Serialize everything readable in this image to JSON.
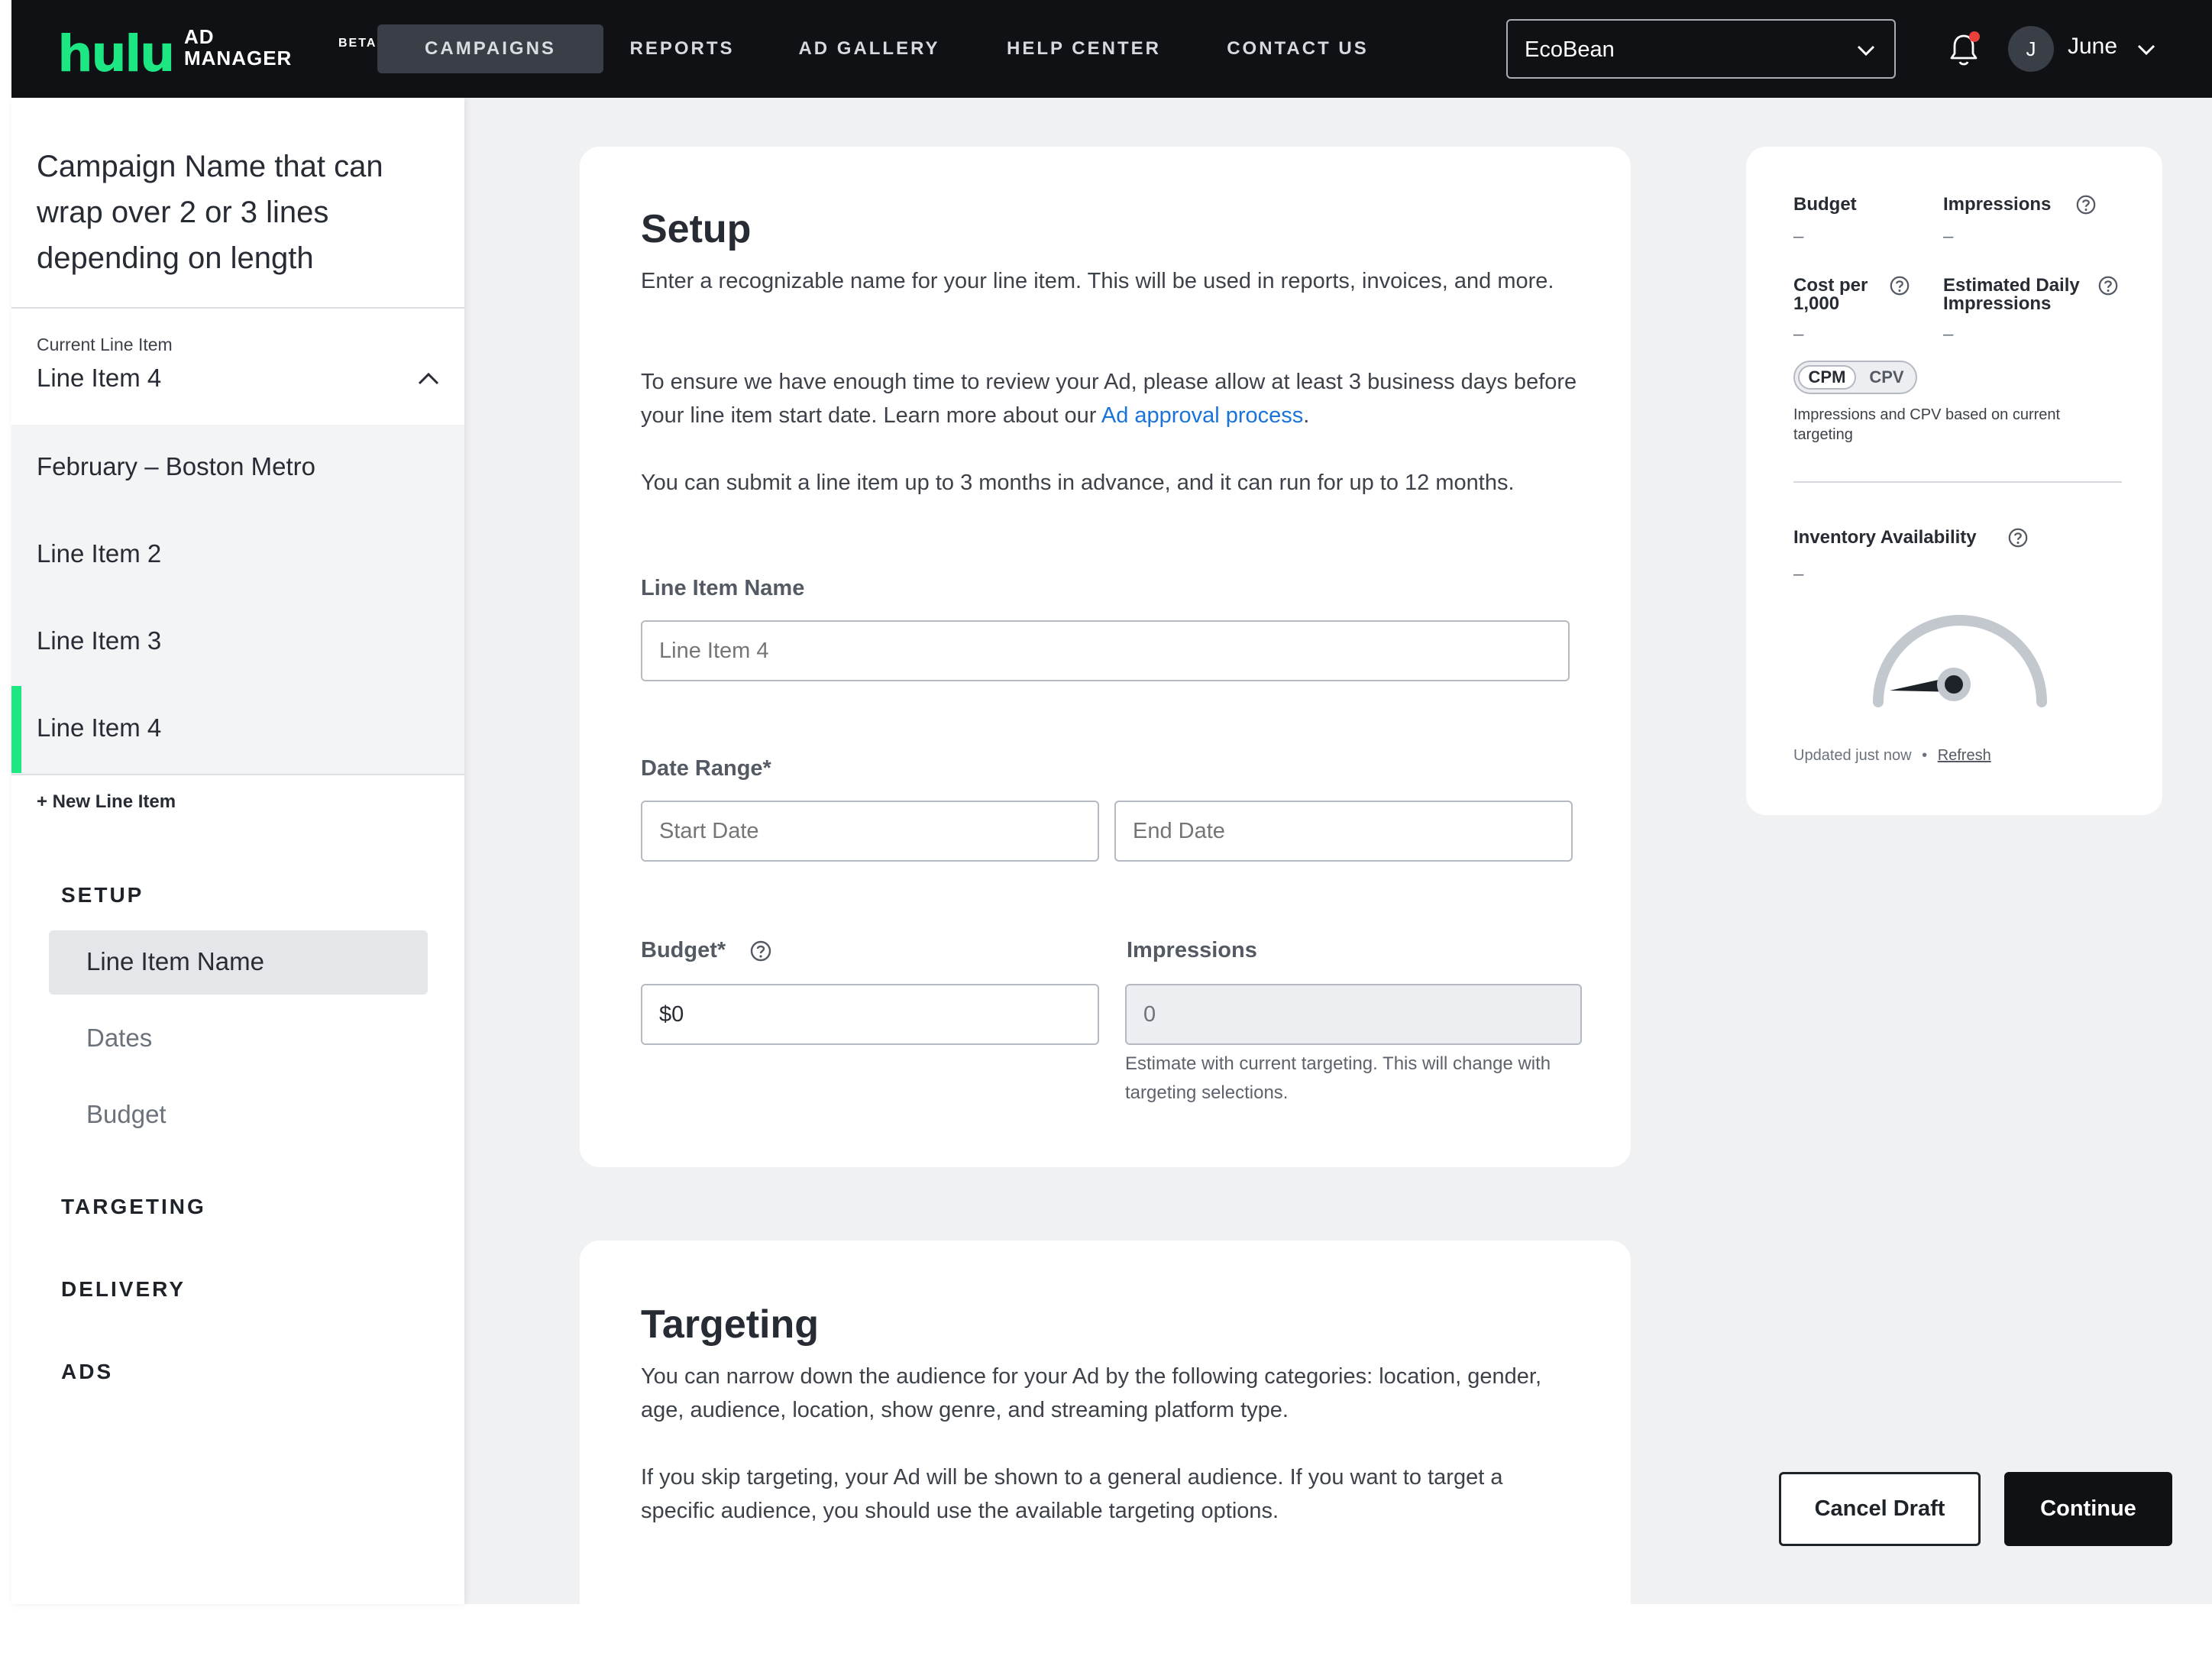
{
  "header": {
    "logo_text": "hulu",
    "logo_ad": "AD",
    "logo_manager": "MANAGER",
    "logo_beta": "BETA",
    "nav": [
      "CAMPAIGNS",
      "REPORTS",
      "AD GALLERY",
      "HELP CENTER",
      "CONTACT US"
    ],
    "active_nav": "CAMPAIGNS",
    "account_select": "EcoBean",
    "user_initial": "J",
    "user_name": "June",
    "notification_dot_color": "#e8413c"
  },
  "sidebar": {
    "campaign_name": "Campaign Name that can wrap over 2 or 3 lines depending on length",
    "current_label": "Current Line Item",
    "current_value": "Line Item 4",
    "line_items": [
      "February – Boston Metro",
      "Line Item 2",
      "Line Item 3",
      "Line Item 4"
    ],
    "new_line_item": "+ New Line Item",
    "sections": [
      "SETUP",
      "TARGETING",
      "DELIVERY",
      "ADS"
    ],
    "setup_subitems": [
      "Line Item Name",
      "Dates",
      "Budget"
    ]
  },
  "setup": {
    "title": "Setup",
    "p1": "Enter a recognizable name for your line item. This will be used in reports, invoices, and more.",
    "p2_before": "To ensure we have enough time to review your Ad, please allow at least 3 business days before your line item start date. Learn more about our ",
    "p2_link": "Ad approval process",
    "p2_after": ".",
    "p3": "You can submit a line item up to 3 months in advance, and it can run for up to 12 months.",
    "name_label": "Line Item Name",
    "name_placeholder": "Line Item 4",
    "date_label": "Date Range*",
    "start_placeholder": "Start Date",
    "end_placeholder": "End Date",
    "budget_label": "Budget*",
    "budget_value": "$0",
    "impressions_label": "Impressions",
    "impressions_value": "0",
    "impressions_hint": "Estimate with current targeting. This will change with targeting selections."
  },
  "targeting": {
    "title": "Targeting",
    "p1": "You can narrow down the audience for your Ad by the following categories: location, gender, age, audience, location, show genre, and streaming platform type.",
    "p2": "If you skip targeting, your Ad will be shown to a general audience. If you want to target a specific audience, you should use the available targeting options."
  },
  "summary": {
    "budget_label": "Budget",
    "budget_value": "–",
    "impressions_label": "Impressions",
    "impressions_value": "–",
    "cpm_label_1": "Cost per",
    "cpm_label_2": "1,000",
    "cpm_value": "–",
    "edi_label_1": "Estimated Daily",
    "edi_label_2": "Impressions",
    "edi_value": "–",
    "toggle_on": "CPM",
    "toggle_off": "CPV",
    "note": "Impressions and CPV based on current targeting",
    "inventory_label": "Inventory Availability",
    "inventory_value": "–",
    "updated": "Updated just now",
    "bullet": "•",
    "refresh": "Refresh"
  },
  "actions": {
    "cancel": "Cancel Draft",
    "continue": "Continue"
  },
  "colors": {
    "brand_green": "#1ce783",
    "topbar": "#0f1115",
    "link_blue": "#1a73d9"
  }
}
